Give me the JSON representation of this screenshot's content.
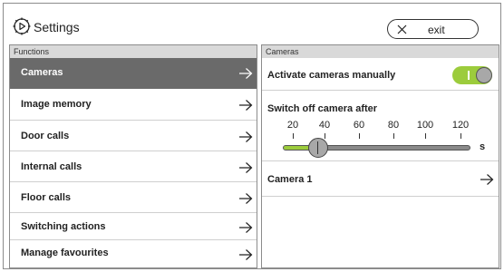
{
  "header": {
    "title": "Settings",
    "settings_icon": "gear-icon",
    "exit_label": "exit",
    "exit_icon": "close-icon"
  },
  "functions": {
    "heading": "Functions",
    "items": [
      {
        "label": "Cameras",
        "selected": true
      },
      {
        "label": "Image memory",
        "selected": false
      },
      {
        "label": "Door calls",
        "selected": false
      },
      {
        "label": "Internal calls",
        "selected": false
      },
      {
        "label": "Floor calls",
        "selected": false
      },
      {
        "label": "Switching actions",
        "selected": false
      },
      {
        "label": "Manage favourites",
        "selected": false
      }
    ],
    "item_icon": "arrow-right-icon"
  },
  "cameras": {
    "heading": "Cameras",
    "activate_label": "Activate cameras manually",
    "activate_on": true,
    "switch_off_label": "Switch off camera after",
    "slider": {
      "ticks": [
        "20",
        "40",
        "60",
        "80",
        "100",
        "120"
      ],
      "min": 20,
      "max": 120,
      "value": 35,
      "unit": "s"
    },
    "camera_item_label": "Camera 1",
    "camera_item_icon": "arrow-right-icon"
  },
  "colors": {
    "accent_green": "#9ccc3c",
    "selected_bg": "#6a6a6a",
    "section_head_bg": "#d9d9d9"
  }
}
